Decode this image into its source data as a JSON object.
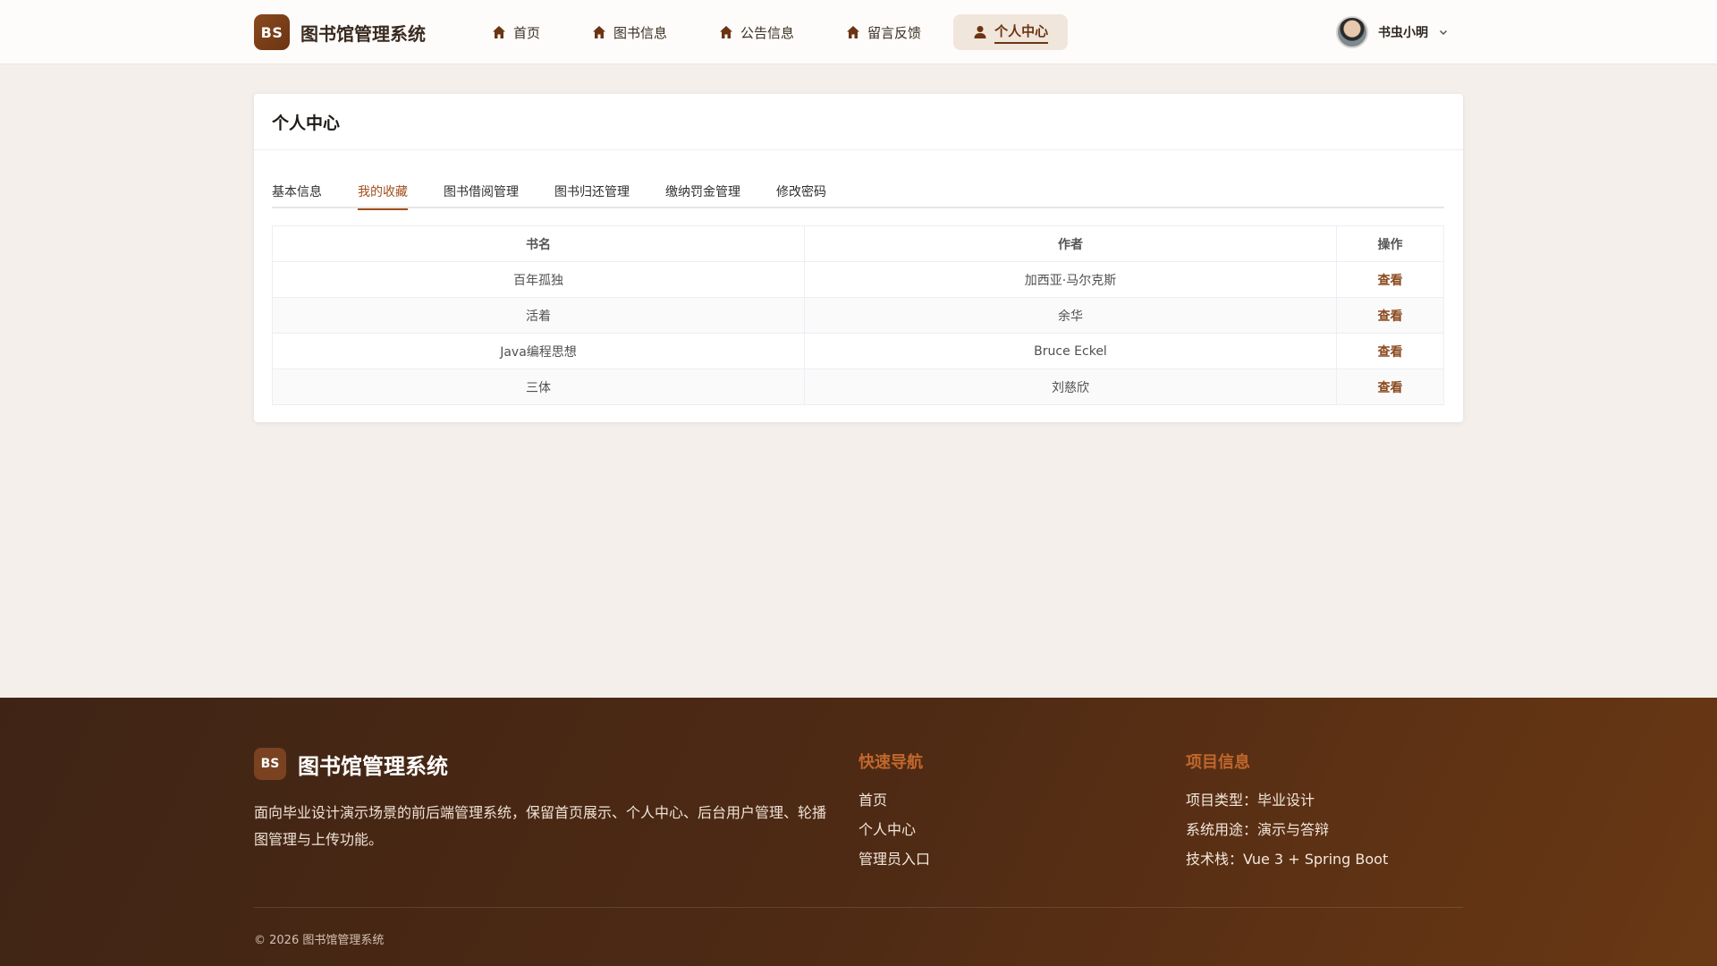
{
  "header": {
    "logo_text": "BS",
    "title": "图书馆管理系统",
    "nav": [
      {
        "label": "首页",
        "icon": "home-icon",
        "active": false
      },
      {
        "label": "图书信息",
        "icon": "home-icon",
        "active": false
      },
      {
        "label": "公告信息",
        "icon": "home-icon",
        "active": false
      },
      {
        "label": "留言反馈",
        "icon": "home-icon",
        "active": false
      },
      {
        "label": "个人中心",
        "icon": "user-icon",
        "active": true
      }
    ],
    "user": {
      "name": "书虫小明",
      "avatar_icon": "avatar-icon",
      "dropdown_icon": "chevron-down-icon"
    }
  },
  "main": {
    "card_title": "个人中心",
    "tabs": [
      {
        "label": "基本信息",
        "active": false
      },
      {
        "label": "我的收藏",
        "active": true
      },
      {
        "label": "图书借阅管理",
        "active": false
      },
      {
        "label": "图书归还管理",
        "active": false
      },
      {
        "label": "缴纳罚金管理",
        "active": false
      },
      {
        "label": "修改密码",
        "active": false
      }
    ],
    "table": {
      "headers": [
        "书名",
        "作者",
        "操作"
      ],
      "rows": [
        {
          "title": "百年孤独",
          "author": "加西亚·马尔克斯",
          "action": "查看"
        },
        {
          "title": "活着",
          "author": "余华",
          "action": "查看"
        },
        {
          "title": "Java编程思想",
          "author": "Bruce Eckel",
          "action": "查看"
        },
        {
          "title": "三体",
          "author": "刘慈欣",
          "action": "查看"
        }
      ]
    }
  },
  "footer": {
    "logo_text": "BS",
    "title": "图书馆管理系统",
    "description": "面向毕业设计演示场景的前后端管理系统，保留首页展示、个人中心、后台用户管理、轮播图管理与上传功能。",
    "quick_nav": {
      "heading": "快速导航",
      "links": [
        "首页",
        "个人中心",
        "管理员入口"
      ]
    },
    "project_info": {
      "heading": "项目信息",
      "items": [
        "项目类型：毕业设计",
        "系统用途：演示与答辩",
        "技术栈：Vue 3 + Spring Boot"
      ]
    },
    "copyright": "© 2026 图书馆管理系统"
  },
  "colors": {
    "accent": "#8a4a1f",
    "tab_active": "#a0501e",
    "footer_heading": "#c0672d",
    "page_bg": "#f4efeb"
  }
}
